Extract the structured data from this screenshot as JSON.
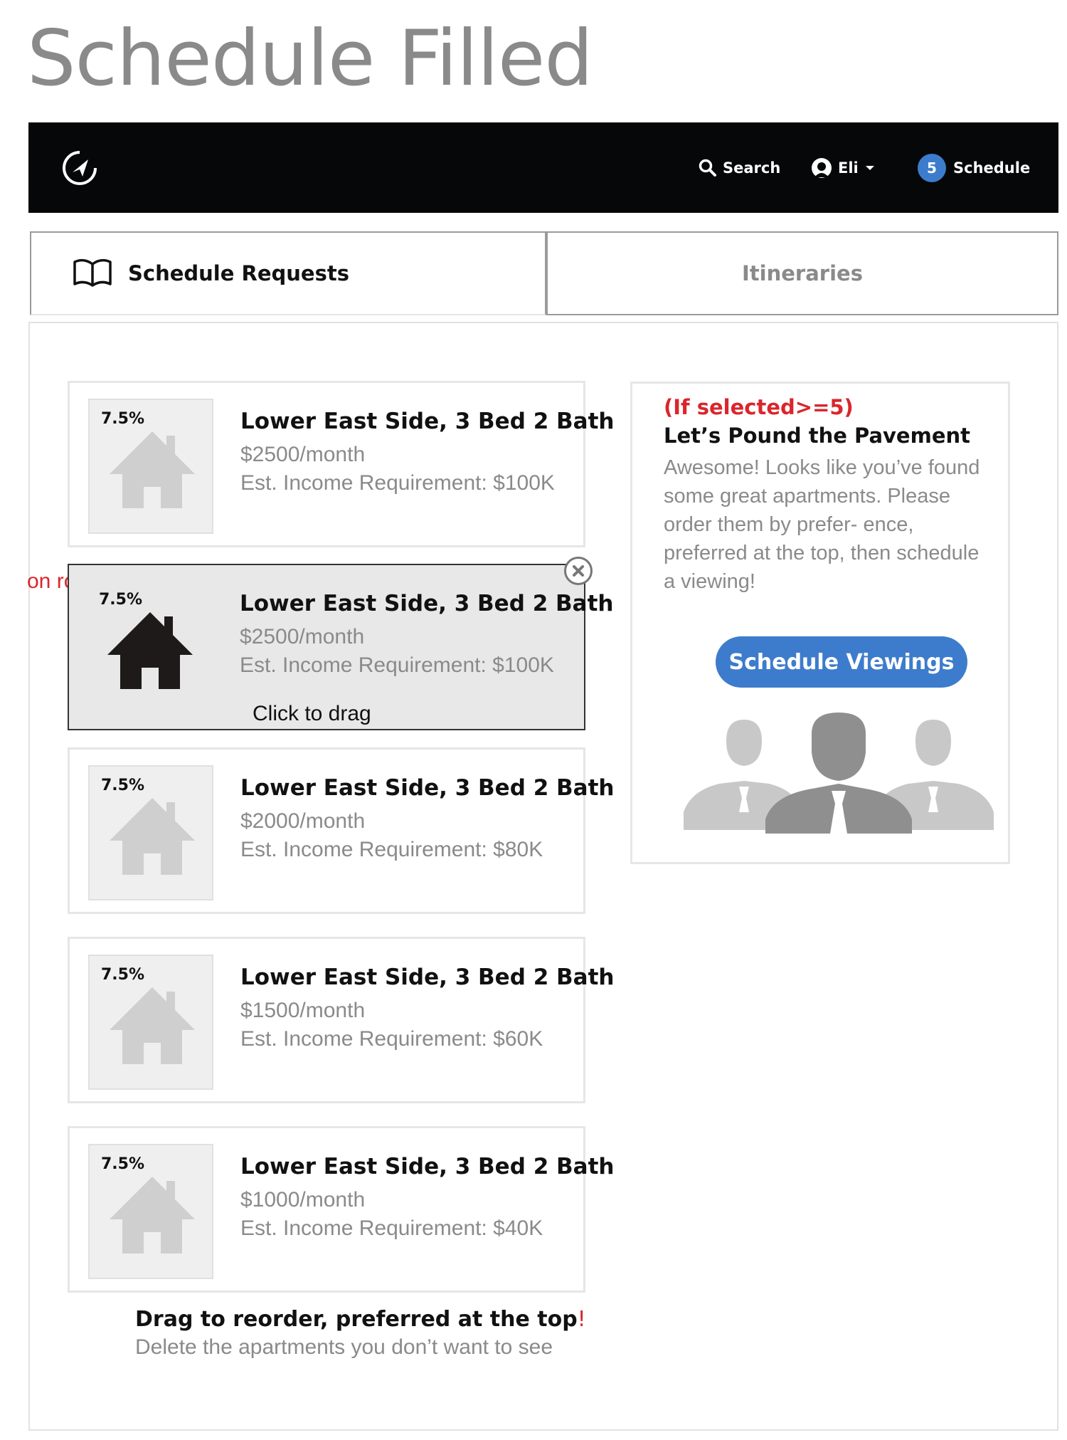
{
  "page_title": "Schedule Filled",
  "topbar": {
    "search_label": "Search",
    "user_label": "Eli",
    "schedule_count": "5",
    "schedule_label": "Schedule"
  },
  "tabs": [
    {
      "label": "Schedule Requests",
      "active": true
    },
    {
      "label": "Itineraries",
      "active": false
    }
  ],
  "rollover_note": "on rollover",
  "listings": [
    {
      "pct": "7.5%",
      "title": "Lower East Side, 3 Bed 2 Bath",
      "price": "$2500/month",
      "income": "Est. Income Requirement: $100K"
    },
    {
      "pct": "7.5%",
      "title": "Lower East Side, 3 Bed 2 Bath",
      "price": "$2500/month",
      "income": "Est. Income Requirement: $100K",
      "hover": true,
      "drag_hint": "Click to drag"
    },
    {
      "pct": "7.5%",
      "title": "Lower East Side, 3 Bed 2 Bath",
      "price": "$2000/month",
      "income": "Est. Income Requirement: $80K"
    },
    {
      "pct": "7.5%",
      "title": "Lower East Side, 3 Bed 2 Bath",
      "price": "$1500/month",
      "income": "Est. Income Requirement: $60K"
    },
    {
      "pct": "7.5%",
      "title": "Lower East Side, 3 Bed 2 Bath",
      "price": "$1000/month",
      "income": "Est. Income Requirement: $40K"
    }
  ],
  "side_panel": {
    "condition": "(If selected>=5)",
    "heading": "Let’s Pound the Pavement",
    "body": "Awesome! Looks like you’ve found some great apartments. Please order them by prefer- ence, preferred at the top, then schedule a viewing!",
    "button_label": "Schedule Viewings"
  },
  "footer": {
    "title": "Drag to reorder, preferred at the top",
    "title_accent": "!",
    "subtitle": "Delete the apartments you don’t want to see"
  },
  "colors": {
    "accent_blue": "#3d7ccc",
    "annotation_red": "#d9262c",
    "topbar_bg": "#060708",
    "muted_text": "#8a8a8a"
  }
}
